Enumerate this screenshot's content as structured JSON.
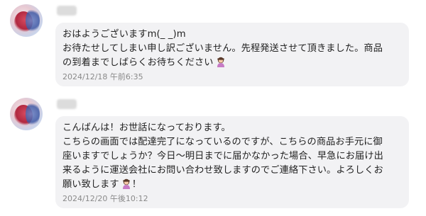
{
  "messages": [
    {
      "sender": "",
      "lines": [
        "おはようございますm(_ _)m",
        "お待たせしてしまい申し訳ございません。先程発送させて頂きました。商品",
        "の到着までしばらくお待ちください"
      ],
      "emoji": "woman-bowing-icon",
      "timestamp": "2024/12/18 午前6:35"
    },
    {
      "sender": "",
      "lines": [
        "こんばんは！お世話になっております。",
        "こちらの画面では配達完了になっているのですが、こちらの商品お手元に御",
        "座いますでしょうか？今日〜明日までに届かなかった場合、早急にお届け出",
        "来るように運送会社にお問い合わせ致しますのでご連絡下さい。よろしくお",
        "願い致します"
      ],
      "line5_suffix": "！",
      "emoji": "woman-bowing-icon",
      "timestamp": "2024/12/20 午後10:12"
    }
  ],
  "colors": {
    "bubble": "#f2f2f4",
    "timestamp": "#8a8a8a",
    "text": "#222222"
  }
}
